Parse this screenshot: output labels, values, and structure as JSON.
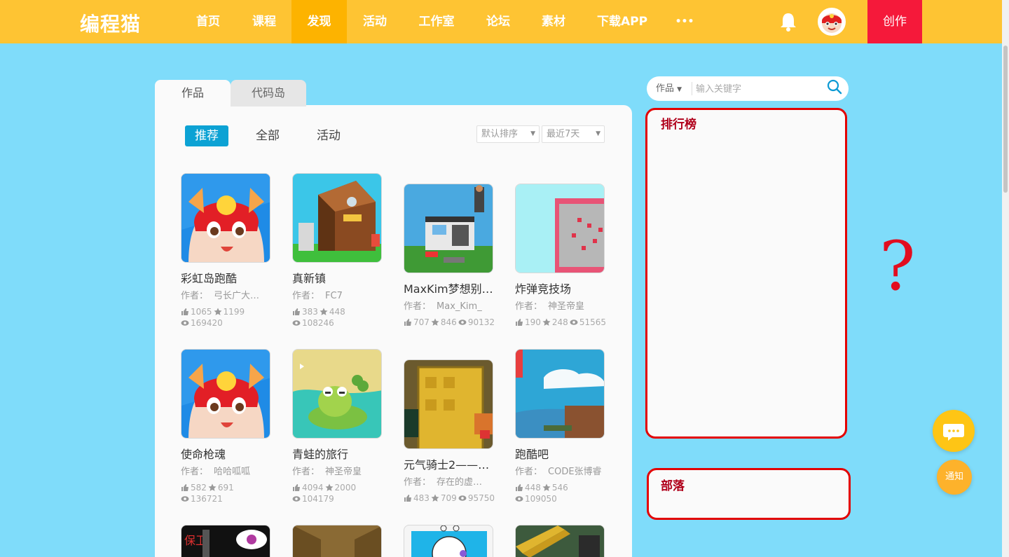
{
  "header": {
    "logo": "编程猫",
    "nav": [
      "首页",
      "课程",
      "发现",
      "活动",
      "工作室",
      "论坛",
      "素材",
      "下载APP",
      "•••"
    ],
    "active_nav": "发现",
    "create_label": "创作"
  },
  "tabs": [
    "作品",
    "代码岛"
  ],
  "filters": [
    "推荐",
    "全部",
    "活动"
  ],
  "sort_select": "默认排序",
  "time_select": "最近7天",
  "works": [
    {
      "title": "彩虹岛跑酷",
      "author_label": "作者：",
      "author": "弓长广大…",
      "likes": "1065",
      "stars": "1199",
      "views": "169420"
    },
    {
      "title": "真新镇",
      "author_label": "作者：",
      "author": "FC7",
      "likes": "383",
      "stars": "448",
      "views": "108246"
    },
    {
      "title": "MaxKim梦想别…",
      "author_label": "作者：",
      "author": "Max_Kim_",
      "likes": "707",
      "stars": "846",
      "views": "90132"
    },
    {
      "title": "炸弹竞技场",
      "author_label": "作者：",
      "author": "神圣帝皇",
      "likes": "190",
      "stars": "248",
      "views": "51565"
    },
    {
      "title": "使命枪魂",
      "author_label": "作者：",
      "author": "哈哈呱呱",
      "likes": "582",
      "stars": "691",
      "views": "136721"
    },
    {
      "title": "青蛙的旅行",
      "author_label": "作者：",
      "author": "神圣帝皇",
      "likes": "4094",
      "stars": "2000",
      "views": "104179"
    },
    {
      "title": "元气骑士2——…",
      "author_label": "作者：",
      "author": "存在的虚…",
      "likes": "483",
      "stars": "709",
      "views": "95750"
    },
    {
      "title": "跑酷吧",
      "author_label": "作者：",
      "author": "CODE张博睿",
      "likes": "448",
      "stars": "546",
      "views": "109050"
    }
  ],
  "third_row_text": "保卫",
  "search": {
    "type": "作品",
    "placeholder": "输入关键字"
  },
  "ranking_title": "排行榜",
  "tribe_title": "部落",
  "question_mark": "?",
  "notify_label": "通知",
  "colors": {
    "topbar": "#fec433",
    "background": "#7fdcfa",
    "accent": "#0ca2d4",
    "create": "#f5193a",
    "highlight_box": "#e30000"
  }
}
